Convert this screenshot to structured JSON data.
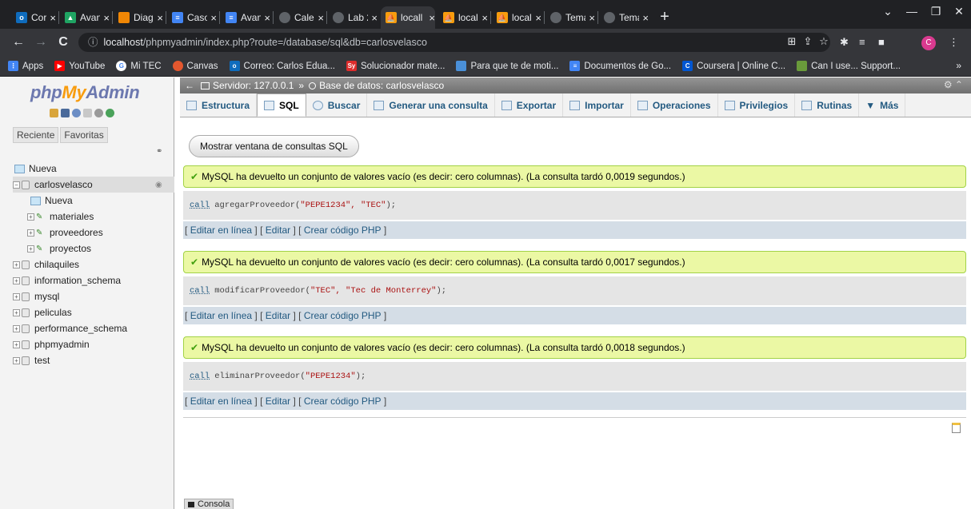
{
  "browser": {
    "tabs": [
      {
        "label": "Corre",
        "icon": "outlook-icon",
        "color": "#0f6cbd"
      },
      {
        "label": "Avan",
        "icon": "drive-icon",
        "color": "#1fa463"
      },
      {
        "label": "Diag",
        "icon": "diagram-icon",
        "color": "#f08705"
      },
      {
        "label": "Caso",
        "icon": "docs-icon",
        "color": "#4285f4"
      },
      {
        "label": "Avan",
        "icon": "docs-icon",
        "color": "#4285f4"
      },
      {
        "label": "Caler",
        "icon": "globe-icon",
        "color": "#5f6368"
      },
      {
        "label": "Lab 2",
        "icon": "globe-icon",
        "color": "#5f6368"
      },
      {
        "label": "locall",
        "icon": "phpmyadmin-icon",
        "color": "#f89c0e"
      },
      {
        "label": "locall",
        "icon": "phpmyadmin-icon",
        "color": "#f89c0e"
      },
      {
        "label": "locall",
        "icon": "phpmyadmin-icon",
        "color": "#f89c0e"
      },
      {
        "label": "Tema",
        "icon": "globe-icon",
        "color": "#5f6368"
      },
      {
        "label": "Tema",
        "icon": "globe-icon",
        "color": "#5f6368"
      }
    ],
    "url_host": "localhost",
    "url_path": "/phpmyadmin/index.php?route=/database/sql&db=carlosvelasco",
    "profile_initial": "C"
  },
  "bookmarks": [
    {
      "label": "Apps",
      "icon": "apps-grid-icon",
      "color": "#4285f4"
    },
    {
      "label": "YouTube",
      "icon": "youtube-icon",
      "color": "#ff0000"
    },
    {
      "label": "Mi TEC",
      "icon": "google-icon",
      "color": "#ffffff"
    },
    {
      "label": "Canvas",
      "icon": "canvas-icon",
      "color": "#e4572e"
    },
    {
      "label": "Correo: Carlos Edua...",
      "icon": "outlook-icon",
      "color": "#0f6cbd"
    },
    {
      "label": "Solucionador mate...",
      "icon": "symbolab-icon",
      "color": "#dd2c2c"
    },
    {
      "label": "Para que te de moti...",
      "icon": "page-icon",
      "color": "#4a90d9"
    },
    {
      "label": "Documentos de Go...",
      "icon": "docs-icon",
      "color": "#4285f4"
    },
    {
      "label": "Coursera | Online C...",
      "icon": "coursera-icon",
      "color": "#0056d2"
    },
    {
      "label": "Can I use... Support...",
      "icon": "caniuse-icon",
      "color": "#6a9b3b"
    }
  ],
  "pma": {
    "logo": {
      "php": "php",
      "my": "My",
      "admin": "Admin"
    },
    "recent_tab": "Reciente",
    "favorites_tab": "Favoritas",
    "tree": [
      {
        "label": "Nueva",
        "type": "new",
        "indent": 0
      },
      {
        "label": "carlosvelasco",
        "type": "db",
        "indent": 0
      },
      {
        "label": "Nueva",
        "type": "new",
        "indent": 1
      },
      {
        "label": "materiales",
        "type": "proc",
        "indent": 1
      },
      {
        "label": "proveedores",
        "type": "proc",
        "indent": 1
      },
      {
        "label": "proyectos",
        "type": "proc",
        "indent": 1
      },
      {
        "label": "chilaquiles",
        "type": "db",
        "indent": 0
      },
      {
        "label": "information_schema",
        "type": "db",
        "indent": 0
      },
      {
        "label": "mysql",
        "type": "db",
        "indent": 0
      },
      {
        "label": "peliculas",
        "type": "db",
        "indent": 0
      },
      {
        "label": "performance_schema",
        "type": "db",
        "indent": 0
      },
      {
        "label": "phpmyadmin",
        "type": "db",
        "indent": 0
      },
      {
        "label": "test",
        "type": "db",
        "indent": 0
      }
    ],
    "breadcrumb": {
      "server": "Servidor: 127.0.0.1",
      "sep": "»",
      "db": "Base de datos: carlosvelasco"
    },
    "menu": [
      "Estructura",
      "SQL",
      "Buscar",
      "Generar una consulta",
      "Exportar",
      "Importar",
      "Operaciones",
      "Privilegios",
      "Rutinas",
      "Más"
    ],
    "active_menu": "SQL",
    "show_sql_button": "Mostrar ventana de consultas SQL",
    "results": [
      {
        "message": "MySQL ha devuelto un conjunto de valores vacío (es decir: cero columnas). (La consulta tardó 0,0019 segundos.)",
        "sql_kw": "call",
        "sql_fn": "agregarProveedor(",
        "sql_args": "\"PEPE1234\", \"TEC\"",
        "sql_end": ");"
      },
      {
        "message": "MySQL ha devuelto un conjunto de valores vacío (es decir: cero columnas). (La consulta tardó 0,0017 segundos.)",
        "sql_kw": "call",
        "sql_fn": "modificarProveedor(",
        "sql_args": "\"TEC\", \"Tec de Monterrey\"",
        "sql_end": ");"
      },
      {
        "message": "MySQL ha devuelto un conjunto de valores vacío (es decir: cero columnas). (La consulta tardó 0,0018 segundos.)",
        "sql_kw": "call",
        "sql_fn": "eliminarProveedor(",
        "sql_args": "\"PEPE1234\"",
        "sql_end": ");"
      }
    ],
    "actions": {
      "inline": "Editar en línea",
      "edit": "Editar",
      "php": "Crear código PHP"
    },
    "console": "Consola"
  }
}
